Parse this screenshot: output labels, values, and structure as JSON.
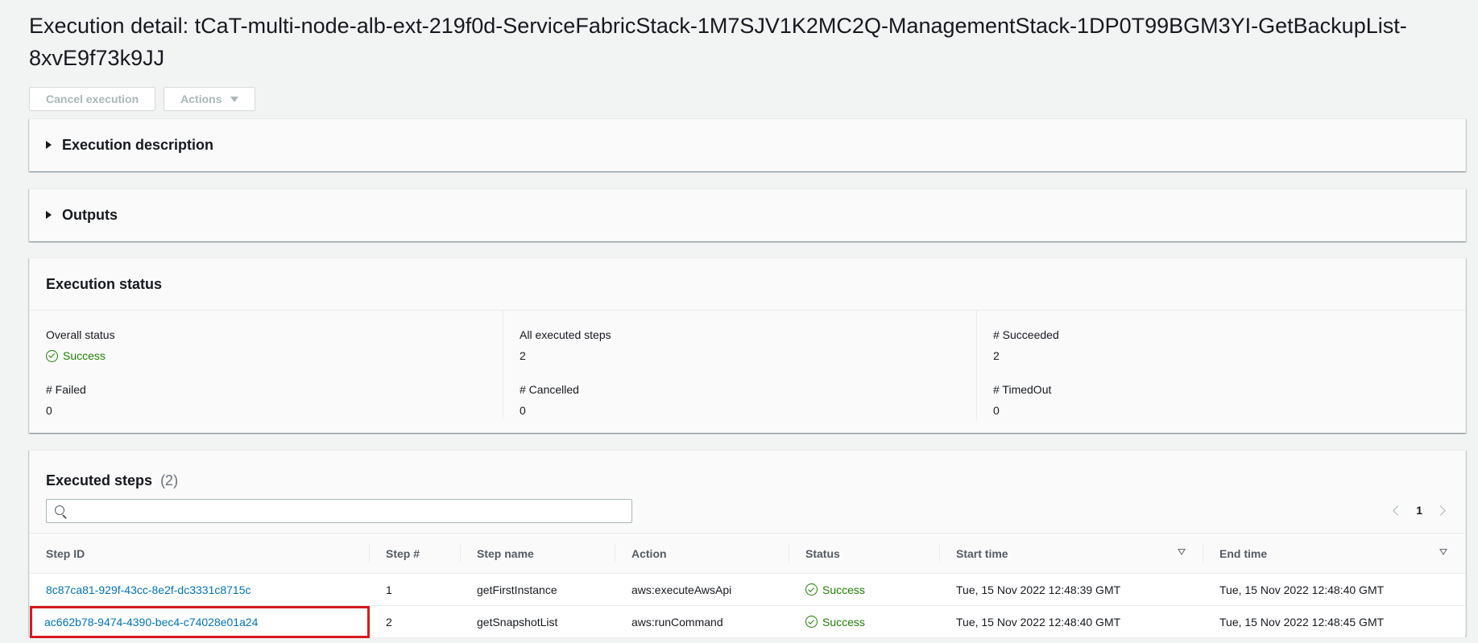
{
  "page": {
    "title": "Execution detail: tCaT-multi-node-alb-ext-219f0d-ServiceFabricStack-1M7SJV1K2MC2Q-ManagementStack-1DP0T99BGM3YI-GetBackupList-8xvE9f73k9JJ"
  },
  "actions": {
    "cancel_label": "Cancel execution",
    "actions_label": "Actions",
    "actions_icon": "caret-down-icon"
  },
  "sections": {
    "description_label": "Execution description",
    "outputs_label": "Outputs",
    "expand_icon": "caret-right-icon"
  },
  "execution_status": {
    "title": "Execution status",
    "fields": [
      {
        "label": "Overall status",
        "value": "Success"
      },
      {
        "label": "All executed steps",
        "value": "2"
      },
      {
        "label": "# Succeeded",
        "value": "2"
      },
      {
        "label": "# Failed",
        "value": "0"
      },
      {
        "label": "# Cancelled",
        "value": "0"
      },
      {
        "label": "# TimedOut",
        "value": "0"
      }
    ]
  },
  "executed_steps": {
    "title": "Executed steps",
    "count": "(2)",
    "search": {
      "value": "",
      "placeholder": ""
    },
    "pagination": {
      "current_page": "1"
    },
    "columns": [
      "Step ID",
      "Step #",
      "Step name",
      "Action",
      "Status",
      "Start time",
      "End time"
    ],
    "rows": [
      {
        "step_id": "8c87ca81-929f-43cc-8e2f-dc3331c8715c",
        "step_num": "1",
        "step_name": "getFirstInstance",
        "action": "aws:executeAwsApi",
        "status": "Success",
        "start_time": "Tue, 15 Nov 2022 12:48:39 GMT",
        "end_time": "Tue, 15 Nov 2022 12:48:40 GMT"
      },
      {
        "step_id": "ac662b78-9474-4390-bec4-c74028e01a24",
        "step_num": "2",
        "step_name": "getSnapshotList",
        "action": "aws:runCommand",
        "status": "Success",
        "start_time": "Tue, 15 Nov 2022 12:48:40 GMT",
        "end_time": "Tue, 15 Nov 2022 12:48:45 GMT"
      }
    ]
  },
  "colors": {
    "success": "#1d8102",
    "link": "#0073bb",
    "highlight_box": "#d7191f"
  }
}
